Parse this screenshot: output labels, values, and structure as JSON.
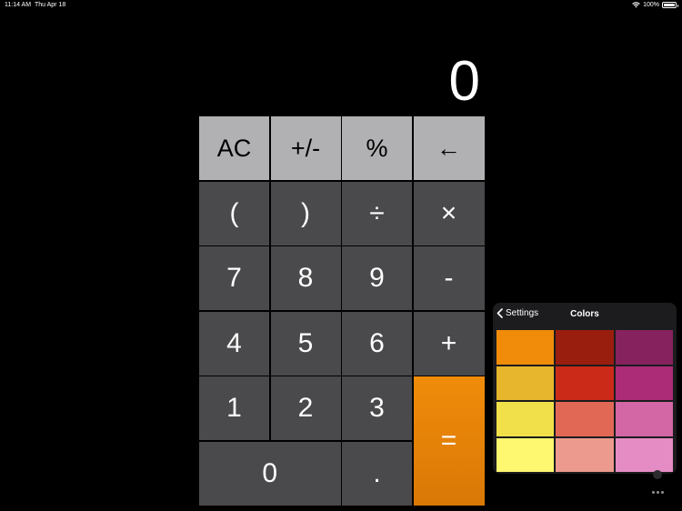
{
  "status_bar": {
    "time": "11:14 AM",
    "date": "Thu Apr 18",
    "battery": "100%"
  },
  "display": {
    "value": "0"
  },
  "keys": [
    {
      "label": "AC",
      "type": "fn",
      "name": "all-clear-button"
    },
    {
      "label": "+/-",
      "type": "fn",
      "name": "sign-toggle-button"
    },
    {
      "label": "%",
      "type": "fn",
      "name": "percent-button"
    },
    {
      "label": "←",
      "type": "fn",
      "name": "backspace-button"
    },
    {
      "label": "(",
      "type": "op",
      "name": "open-paren-button"
    },
    {
      "label": ")",
      "type": "op",
      "name": "close-paren-button"
    },
    {
      "label": "÷",
      "type": "op",
      "name": "divide-button"
    },
    {
      "label": "×",
      "type": "op",
      "name": "multiply-button"
    },
    {
      "label": "7",
      "type": "num",
      "name": "digit-7-button"
    },
    {
      "label": "8",
      "type": "num",
      "name": "digit-8-button"
    },
    {
      "label": "9",
      "type": "num",
      "name": "digit-9-button"
    },
    {
      "label": "-",
      "type": "op",
      "name": "subtract-button"
    },
    {
      "label": "4",
      "type": "num",
      "name": "digit-4-button"
    },
    {
      "label": "5",
      "type": "num",
      "name": "digit-5-button"
    },
    {
      "label": "6",
      "type": "num",
      "name": "digit-6-button"
    },
    {
      "label": "+",
      "type": "op",
      "name": "add-button"
    },
    {
      "label": "1",
      "type": "num",
      "name": "digit-1-button"
    },
    {
      "label": "2",
      "type": "num",
      "name": "digit-2-button"
    },
    {
      "label": "3",
      "type": "num",
      "name": "digit-3-button"
    },
    {
      "label": "=",
      "type": "eq",
      "name": "equals-button"
    },
    {
      "label": "0",
      "type": "zero",
      "name": "digit-0-button"
    },
    {
      "label": ".",
      "type": "num",
      "name": "decimal-button"
    }
  ],
  "colors_panel": {
    "back_label": "Settings",
    "title": "Colors",
    "swatches": [
      "#f08c0a",
      "#9a1e0e",
      "#86225e",
      "#e8b62c",
      "#cc2a18",
      "#ac2c78",
      "#f2e04a",
      "#e26856",
      "#d366a4",
      "#fdf870",
      "#ec9a8e",
      "#e58cc5"
    ]
  }
}
